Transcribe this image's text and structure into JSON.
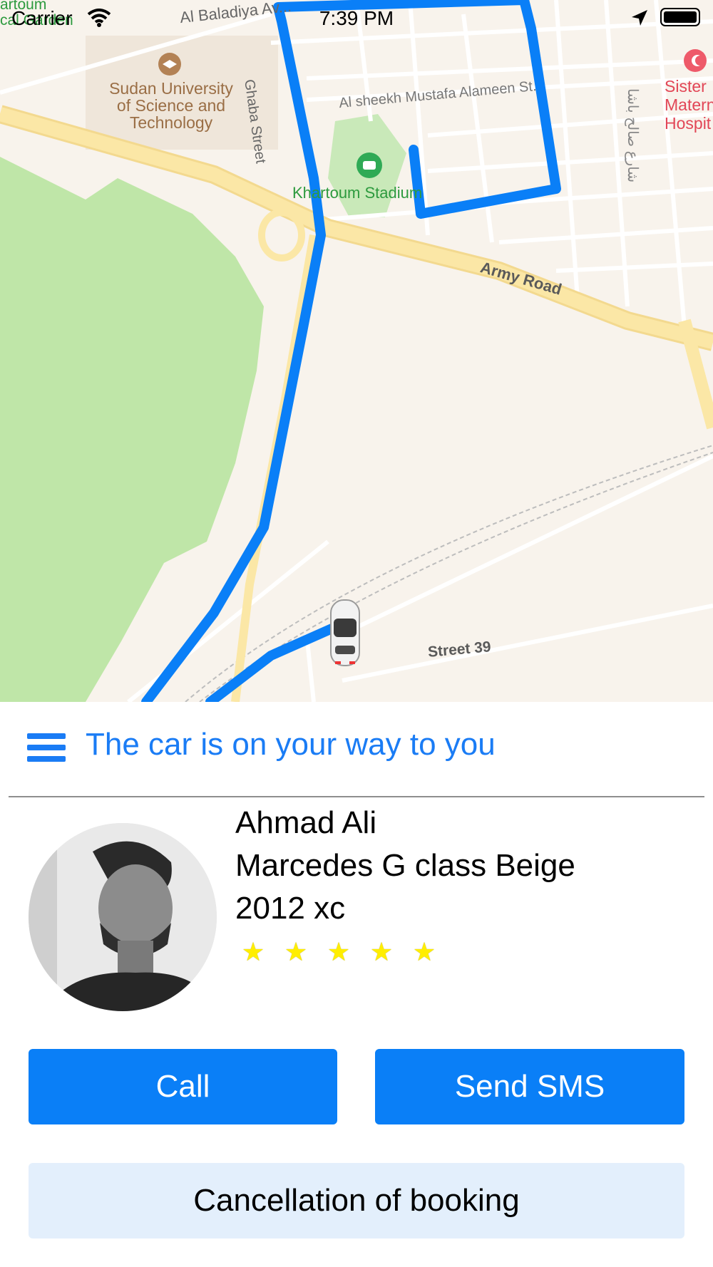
{
  "status_bar": {
    "carrier": "Carrier",
    "time": "7:39 PM"
  },
  "map": {
    "labels": {
      "garden": "artoum\ncal Garden",
      "road_baladiya": "Al Baladiya Av...",
      "street_vertical": "Ghaba Street",
      "university": "Sudan University\nof Science and\nTechnology",
      "street_sheekh": "Al sheekh Mustafa Alameen St.",
      "arabic_street": "شارع صالح باشا",
      "hospital": "Sister\nMatern\nHospit",
      "stadium": "Khartoum Stadium",
      "army_road": "Army Road",
      "street_39": "Street 39"
    },
    "colors": {
      "route": "#0a7ff7",
      "park": "#bfe6a8",
      "road": "#fbe7a6",
      "background": "#f8f3ec"
    }
  },
  "trip": {
    "status_message": "The car is on your way to you",
    "driver_name": "Ahmad Ali",
    "car_model": "Marcedes G class Beige",
    "car_year": "2012 xc",
    "rating": 5
  },
  "actions": {
    "call": "Call",
    "sms": "Send SMS",
    "cancel": "Cancellation of booking"
  },
  "icons": {
    "menu": "hamburger-icon",
    "signal": "wifi-icon",
    "location": "location-arrow-icon",
    "battery": "battery-icon",
    "car": "car-icon",
    "university": "graduation-cap-icon",
    "stadium": "stadium-icon",
    "hospital": "crescent-icon",
    "star": "star-icon"
  }
}
